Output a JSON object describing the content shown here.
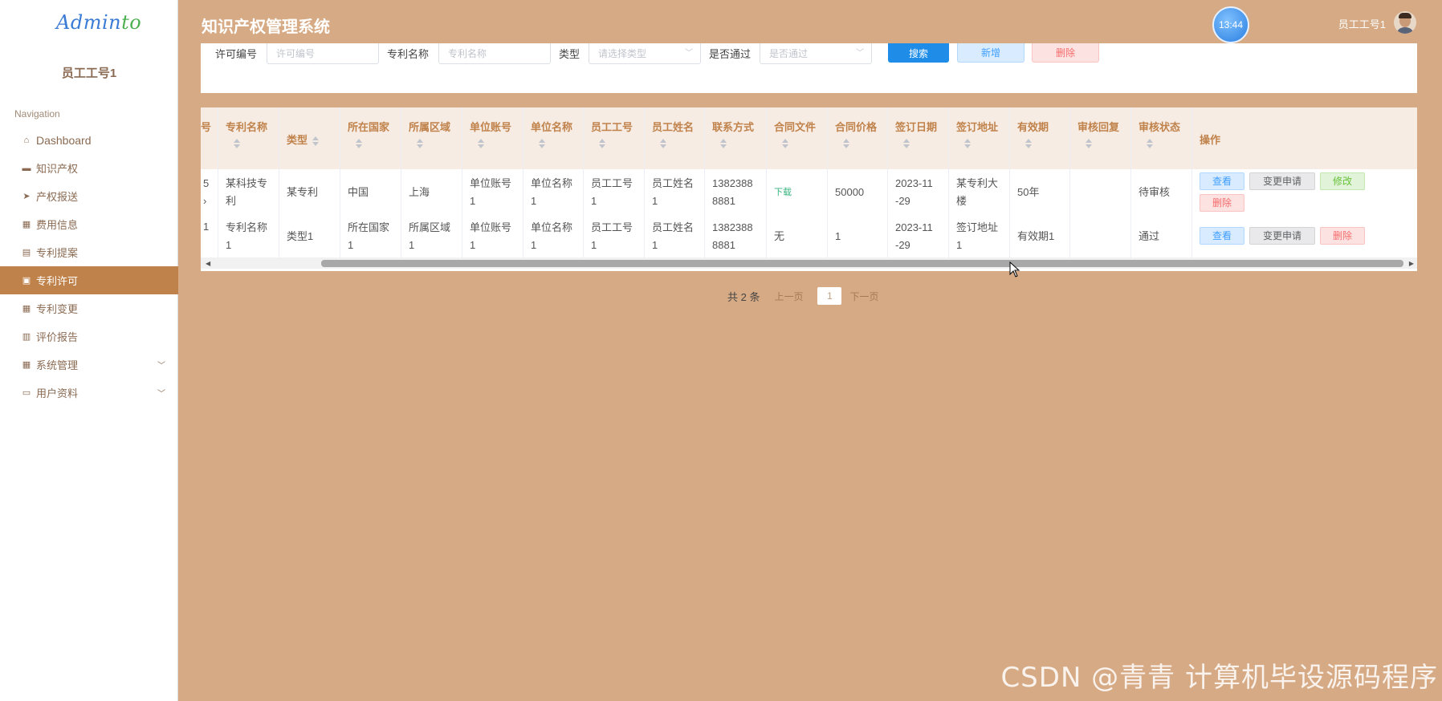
{
  "sidebar": {
    "logo_part1": "Admin",
    "logo_part2": "to",
    "user": "员工工号1",
    "nav_title": "Navigation",
    "items": [
      {
        "label": "Dashboard",
        "icon": "home-icon"
      },
      {
        "label": "知识产权",
        "icon": "briefcase-icon"
      },
      {
        "label": "产权报送",
        "icon": "send-icon"
      },
      {
        "label": "费用信息",
        "icon": "grid-icon"
      },
      {
        "label": "专利提案",
        "icon": "comment-icon"
      },
      {
        "label": "专利许可",
        "icon": "clipboard-icon"
      },
      {
        "label": "专利变更",
        "icon": "grid-icon"
      },
      {
        "label": "评价报告",
        "icon": "chart-icon"
      },
      {
        "label": "系统管理",
        "icon": "grid-icon"
      },
      {
        "label": "用户资料",
        "icon": "card-icon"
      }
    ]
  },
  "header": {
    "title": "知识产权管理系统",
    "clock": "13:44",
    "user": "员工工号1"
  },
  "search": {
    "license_label": "许可编号",
    "license_placeholder": "许可编号",
    "patent_label": "专利名称",
    "patent_placeholder": "专利名称",
    "type_label": "类型",
    "type_placeholder": "请选择类型",
    "passed_label": "是否通过",
    "passed_placeholder": "是否通过",
    "search_btn": "搜索",
    "add_btn": "新增",
    "delete_btn": "删除"
  },
  "table": {
    "columns": [
      "号",
      "专利名称",
      "类型",
      "所在国家",
      "所属区域",
      "单位账号",
      "单位名称",
      "员工工号",
      "员工姓名",
      "联系方式",
      "合同文件",
      "合同价格",
      "签订日期",
      "签订地址",
      "有效期",
      "审核回复",
      "审核状态",
      "操作"
    ],
    "rows": [
      {
        "id_line1": "5",
        "id_line2": "›",
        "patent_line1": "某科技专",
        "patent_line2": "利",
        "type": "某专利",
        "country": "中国",
        "region": "上海",
        "account_line1": "单位账号",
        "account_line2": "1",
        "unit_line1": "单位名称",
        "unit_line2": "1",
        "emp_no_line1": "员工工号",
        "emp_no_line2": "1",
        "emp_name_line1": "员工姓名",
        "emp_name_line2": "1",
        "phone_line1": "1382388",
        "phone_line2": "8881",
        "contract": "下载",
        "price": "50000",
        "date_line1": "2023-11",
        "date_line2": "-29",
        "address_line1": "某专利大",
        "address_line2": "楼",
        "validity": "50年",
        "reply": "",
        "status": "待审核",
        "ops": [
          "查看",
          "变更申请",
          "修改",
          "删除"
        ]
      },
      {
        "id_line1": "1",
        "id_line2": "",
        "patent_line1": "专利名称",
        "patent_line2": "1",
        "type": "类型1",
        "country_line1": "所在国家",
        "country_line2": "1",
        "region_line1": "所属区域",
        "region_line2": "1",
        "account_line1": "单位账号",
        "account_line2": "1",
        "unit_line1": "单位名称",
        "unit_line2": "1",
        "emp_no_line1": "员工工号",
        "emp_no_line2": "1",
        "emp_name_line1": "员工姓名",
        "emp_name_line2": "1",
        "phone_line1": "1382388",
        "phone_line2": "8881",
        "contract": "无",
        "price": "1",
        "date_line1": "2023-11",
        "date_line2": "-29",
        "address_line1": "签订地址",
        "address_line2": "1",
        "validity": "有效期1",
        "reply": "",
        "status": "通过",
        "ops": [
          "查看",
          "变更申请",
          "删除"
        ]
      }
    ]
  },
  "pager": {
    "total": "共 2 条",
    "prev": "上一页",
    "page": "1",
    "next": "下一页"
  },
  "watermark": "CSDN @青青  计算机毕设源码程序"
}
